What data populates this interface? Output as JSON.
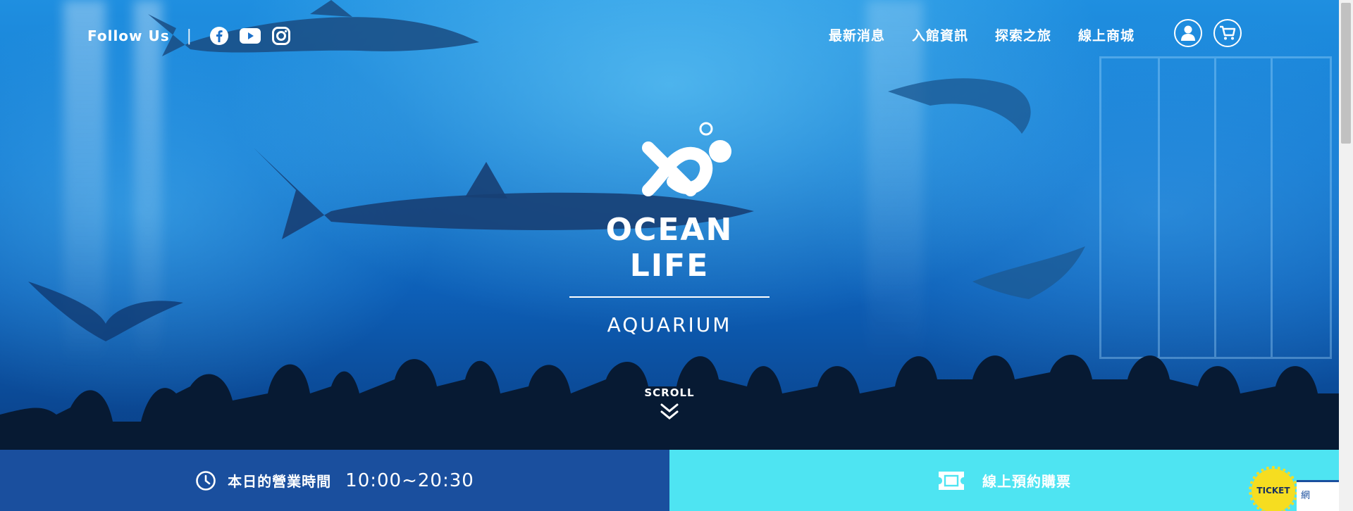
{
  "header": {
    "follow_label": "Follow Us",
    "separator": "|",
    "social": [
      {
        "icon": "facebook-icon"
      },
      {
        "icon": "youtube-icon"
      },
      {
        "icon": "instagram-icon"
      }
    ],
    "nav": [
      {
        "label": "最新消息"
      },
      {
        "label": "入館資訊"
      },
      {
        "label": "探索之旅"
      },
      {
        "label": "線上商城"
      }
    ],
    "account_icon": "user-icon",
    "cart_icon": "cart-icon"
  },
  "hero": {
    "brand": "OCEAN LIFE",
    "subtitle": "AQUARIUM",
    "scroll_label": "SCROLL"
  },
  "bottom_bar": {
    "hours_label": "本日的營業時間",
    "hours_value": "10:00~20:30",
    "ticket_label": "線上預約購票",
    "badge_label": "TICKET",
    "side_text": "網"
  },
  "colors": {
    "hours_bg": "#1a4f9e",
    "ticket_bg": "#4ee4f2",
    "badge_bg": "#f6dd20"
  }
}
